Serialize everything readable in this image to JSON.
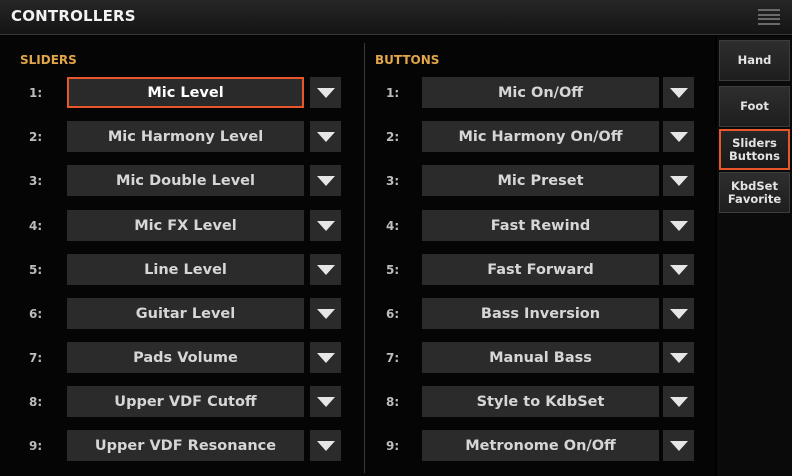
{
  "header": {
    "title": "CONTROLLERS",
    "menu_icon": "menu-icon"
  },
  "sliders": {
    "title": "SLIDERS",
    "selected_index": 0,
    "items": [
      {
        "index": "1:",
        "label": "Mic Level"
      },
      {
        "index": "2:",
        "label": "Mic Harmony Level"
      },
      {
        "index": "3:",
        "label": "Mic Double Level"
      },
      {
        "index": "4:",
        "label": "Mic FX Level"
      },
      {
        "index": "5:",
        "label": "Line Level"
      },
      {
        "index": "6:",
        "label": "Guitar Level"
      },
      {
        "index": "7:",
        "label": "Pads Volume"
      },
      {
        "index": "8:",
        "label": "Upper VDF Cutoff"
      },
      {
        "index": "9:",
        "label": "Upper VDF Resonance"
      }
    ]
  },
  "buttons": {
    "title": "BUTTONS",
    "items": [
      {
        "index": "1:",
        "label": "Mic On/Off"
      },
      {
        "index": "2:",
        "label": "Mic Harmony On/Off"
      },
      {
        "index": "3:",
        "label": "Mic Preset"
      },
      {
        "index": "4:",
        "label": "Fast Rewind"
      },
      {
        "index": "5:",
        "label": "Fast Forward"
      },
      {
        "index": "6:",
        "label": "Bass Inversion"
      },
      {
        "index": "7:",
        "label": "Manual Bass"
      },
      {
        "index": "8:",
        "label": "Style to KdbSet"
      },
      {
        "index": "9:",
        "label": "Metronome On/Off"
      }
    ]
  },
  "side_tabs": [
    {
      "label": "Hand",
      "active": false
    },
    {
      "label": "Foot",
      "active": false
    },
    {
      "label": "Sliders\nButtons",
      "active": true
    },
    {
      "label": "KbdSet\nFavorite",
      "active": false
    }
  ],
  "colors": {
    "accent": "#e8572a",
    "section_title": "#e2a54a",
    "field_bg": "#2b2b2b"
  }
}
